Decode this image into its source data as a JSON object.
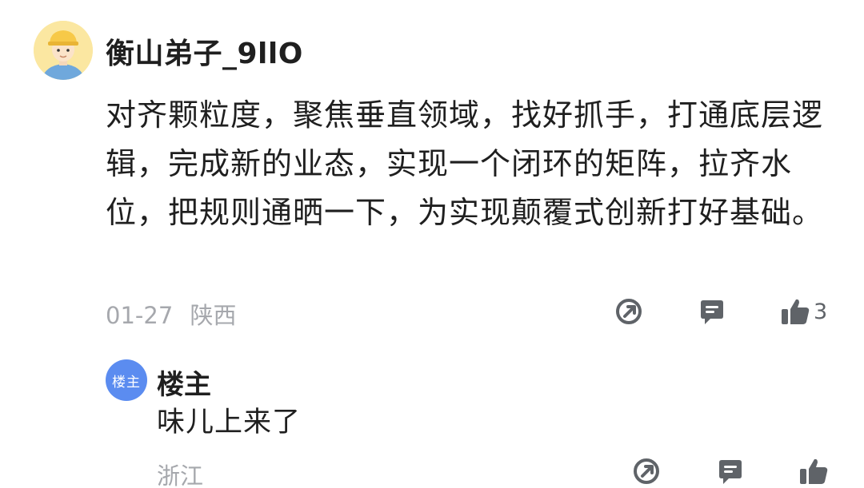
{
  "comment": {
    "username": "衡山弟子_9llO",
    "text": "对齐颗粒度，聚焦垂直领域，找好抓手，打通底层逻辑，完成新的业态，实现一个闭环的矩阵，拉齐水位，把规则通晒一下，为实现颠覆式创新打好基础。",
    "date": "01-27",
    "location": "陕西",
    "like_count": "3",
    "icons": {
      "share": "share-icon",
      "reply": "reply-icon",
      "like": "thumbs-up-icon"
    }
  },
  "reply": {
    "badge": "楼主",
    "author": "楼主",
    "text": "味儿上来了",
    "location": "浙江"
  },
  "colors": {
    "text": "#1f1f1f",
    "meta": "#a6a8ad",
    "icon": "#5f6368",
    "badge": "#5b8cf0",
    "avatar_bg": "#fbe7a1"
  }
}
